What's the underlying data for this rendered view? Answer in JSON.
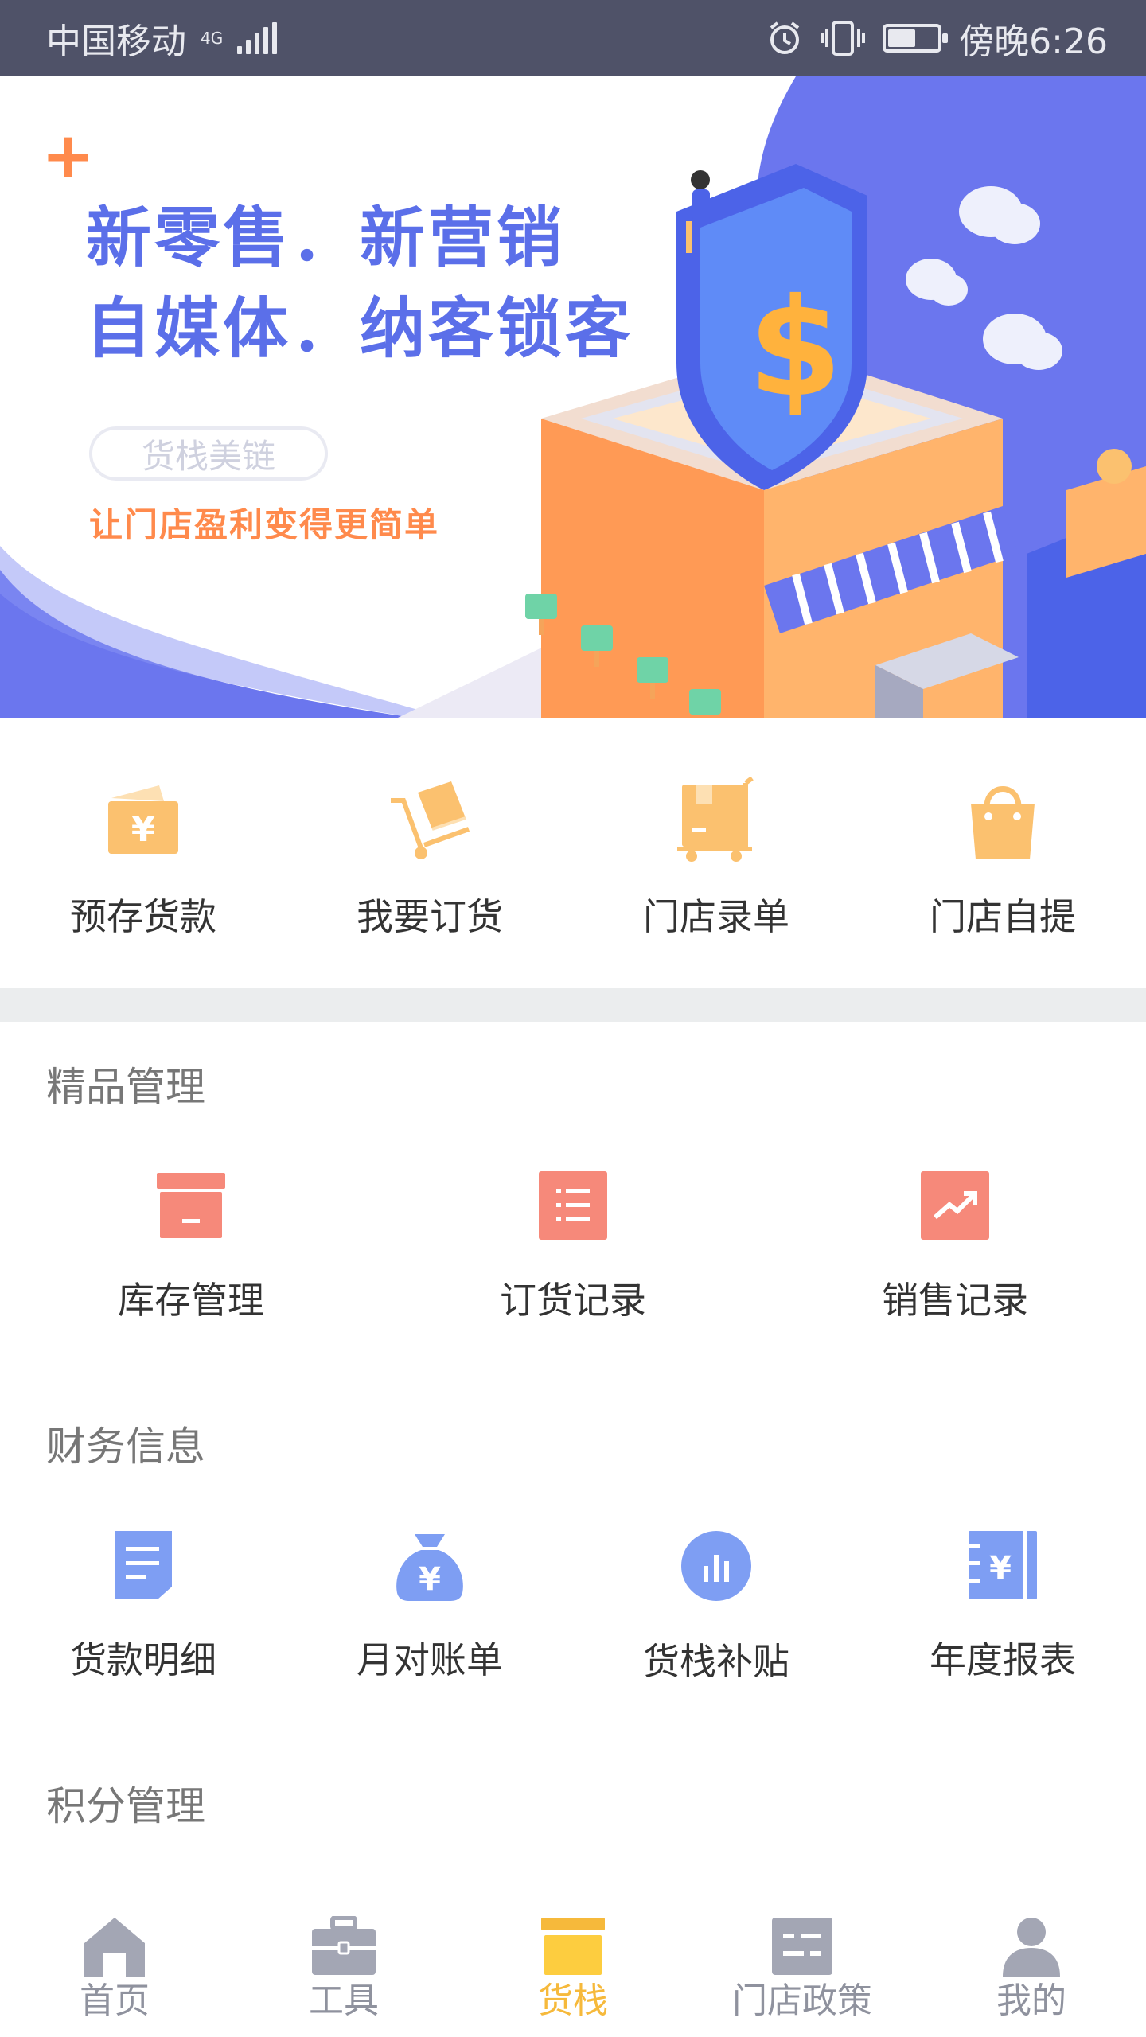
{
  "status_bar": {
    "carrier": "中国移动",
    "network": "4G",
    "time": "傍晚6:26"
  },
  "banner": {
    "headline_1": "新零售．新营销",
    "headline_2": "自媒体．纳客锁客",
    "tag": "货栈美链",
    "subtitle": "让门店盈利变得更简单"
  },
  "quick_actions": [
    {
      "label": "预存货款",
      "icon": "wallet-yen-icon"
    },
    {
      "label": "我要订货",
      "icon": "cart-box-icon"
    },
    {
      "label": "门店录单",
      "icon": "trolley-box-icon"
    },
    {
      "label": "门店自提",
      "icon": "shopping-bag-icon"
    }
  ],
  "sections": {
    "boutique": {
      "title": "精品管理",
      "items": [
        {
          "label": "库存管理",
          "icon": "inventory-box-icon"
        },
        {
          "label": "订货记录",
          "icon": "list-icon"
        },
        {
          "label": "销售记录",
          "icon": "trend-chart-icon"
        }
      ]
    },
    "finance": {
      "title": "财务信息",
      "items": [
        {
          "label": "货款明细",
          "icon": "document-icon"
        },
        {
          "label": "月对账单",
          "icon": "money-bag-icon"
        },
        {
          "label": "货栈补贴",
          "icon": "bar-chart-icon"
        },
        {
          "label": "年度报表",
          "icon": "yen-report-icon"
        }
      ]
    },
    "points": {
      "title": "积分管理"
    }
  },
  "bottom_nav": [
    {
      "label": "首页",
      "icon": "home-icon",
      "active": false
    },
    {
      "label": "工具",
      "icon": "toolbox-icon",
      "active": false
    },
    {
      "label": "货栈",
      "icon": "warehouse-icon",
      "active": true
    },
    {
      "label": "门店政策",
      "icon": "policy-icon",
      "active": false
    },
    {
      "label": "我的",
      "icon": "user-icon",
      "active": false
    }
  ],
  "colors": {
    "status_bar": "#4f5268",
    "banner_blue": "#6b76ee",
    "accent_orange": "#ff8a4c",
    "quick_icon": "#fbc16f",
    "boutique_icon": "#f6897a",
    "finance_icon": "#7e9ef3",
    "nav_active": "#f6b93b",
    "nav_inactive": "#a3a6b4"
  }
}
